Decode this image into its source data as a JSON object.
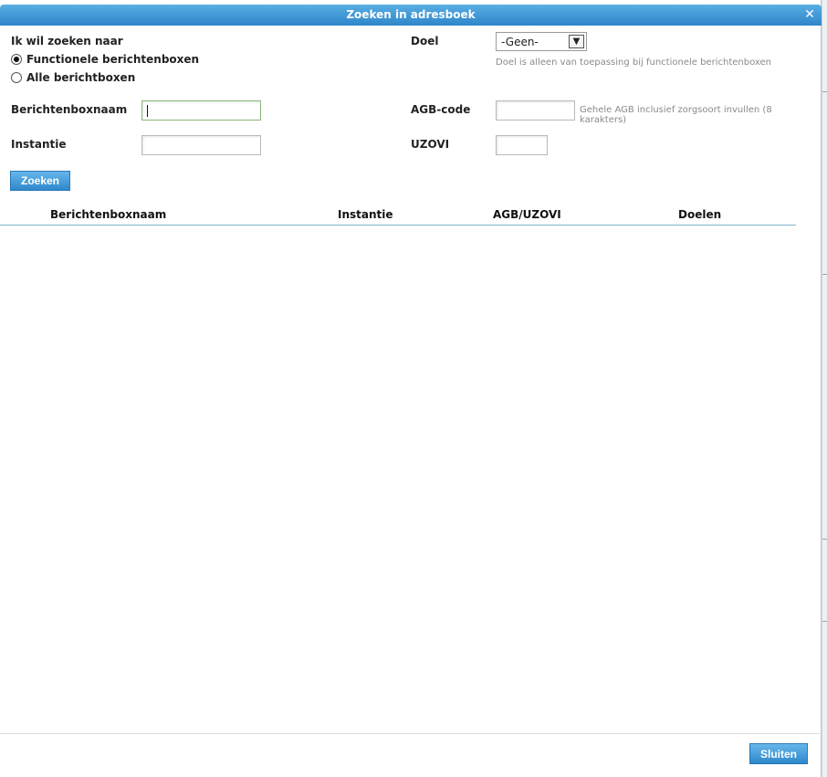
{
  "dialog": {
    "title": "Zoeken in adresboek",
    "close_icon": "close-icon"
  },
  "search_type": {
    "label": "Ik wil zoeken naar",
    "options": [
      {
        "label": "Functionele berichtenboxen",
        "checked": true
      },
      {
        "label": "Alle berichtboxen",
        "checked": false
      }
    ]
  },
  "fields": {
    "mailbox_name_label": "Berichtenboxnaam",
    "mailbox_name_value": "",
    "institution_label": "Instantie",
    "institution_value": "",
    "purpose_label": "Doel",
    "purpose_selected": "-Geen-",
    "purpose_hint": "Doel is alleen van toepassing bij functionele berichtenboxen",
    "agb_label": "AGB-code",
    "agb_value": "",
    "agb_hint": "Gehele AGB inclusief zorgsoort invullen (8 karakters)",
    "uzovi_label": "UZOVI",
    "uzovi_value": ""
  },
  "buttons": {
    "search": "Zoeken",
    "close": "Sluiten"
  },
  "results_table": {
    "columns": [
      "Berichtenboxnaam",
      "Instantie",
      "AGB/UZOVI",
      "Doelen"
    ],
    "rows": []
  },
  "colors": {
    "titlebar": "#2d86c9",
    "button": "#3a8fd0"
  }
}
